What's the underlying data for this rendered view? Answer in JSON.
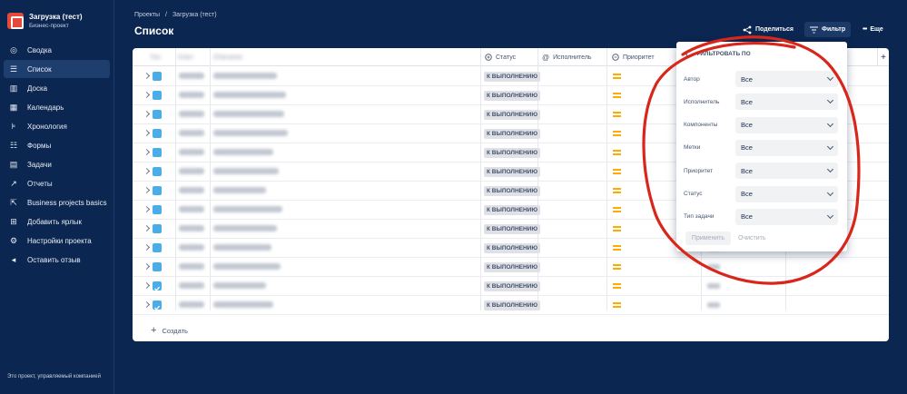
{
  "sidebar": {
    "project_name": "Загрузка (тест)",
    "project_type": "Бизнес-проект",
    "items": [
      {
        "label": "Сводка",
        "icon": "globe-icon"
      },
      {
        "label": "Список",
        "icon": "list-icon",
        "active": true
      },
      {
        "label": "Доска",
        "icon": "board-icon"
      },
      {
        "label": "Календарь",
        "icon": "calendar-icon"
      },
      {
        "label": "Хронология",
        "icon": "timeline-icon"
      },
      {
        "label": "Формы",
        "icon": "forms-icon"
      },
      {
        "label": "Задачи",
        "icon": "tasks-icon"
      },
      {
        "label": "Отчеты",
        "icon": "reports-icon"
      },
      {
        "label": "Business projects basics",
        "icon": "external-link-icon"
      },
      {
        "label": "Добавить ярлык",
        "icon": "add-shortcut-icon"
      },
      {
        "label": "Настройки проекта",
        "icon": "gear-icon"
      },
      {
        "label": "Оставить отзыв",
        "icon": "megaphone-icon"
      }
    ],
    "footer": "Это проект, управляемый компанией"
  },
  "header": {
    "breadcrumb": [
      "Проекты",
      "/",
      "Загрузка (тест)"
    ],
    "title": "Список",
    "share_label": "Поделиться",
    "filter_label": "Фильтр",
    "more_label": "Еще"
  },
  "table": {
    "columns": {
      "type": "Тип",
      "key": "Ключ",
      "summary": "Описание",
      "status": "Статус",
      "assignee": "Исполнитель",
      "priority": "Приоритет"
    },
    "rows": [
      {
        "status": "К ВЫПОЛНЕНИЮ",
        "checked": false
      },
      {
        "status": "К ВЫПОЛНЕНИЮ",
        "checked": false
      },
      {
        "status": "К ВЫПОЛНЕНИЮ",
        "checked": false
      },
      {
        "status": "К ВЫПОЛНЕНИЮ",
        "checked": false
      },
      {
        "status": "К ВЫПОЛНЕНИЮ",
        "checked": false
      },
      {
        "status": "К ВЫПОЛНЕНИЮ",
        "checked": false
      },
      {
        "status": "К ВЫПОЛНЕНИЮ",
        "checked": false
      },
      {
        "status": "К ВЫПОЛНЕНИЮ",
        "checked": false
      },
      {
        "status": "К ВЫПОЛНЕНИЮ",
        "checked": false
      },
      {
        "status": "К ВЫПОЛНЕНИЮ",
        "checked": false
      },
      {
        "status": "К ВЫПОЛНЕНИЮ",
        "checked": false
      },
      {
        "status": "К ВЫПОЛНЕНИЮ",
        "checked": true
      },
      {
        "status": "К ВЫПОЛНЕНИЮ",
        "checked": true
      }
    ],
    "create_label": "Создать",
    "add_column_label": "+"
  },
  "filter_panel": {
    "title": "ФИЛЬТРОВАТЬ ПО",
    "fields": [
      {
        "label": "Автор",
        "value": "Все"
      },
      {
        "label": "Исполнитель",
        "value": "Все"
      },
      {
        "label": "Компоненты",
        "value": "Все"
      },
      {
        "label": "Метки",
        "value": "Все"
      },
      {
        "label": "Приоритет",
        "value": "Все"
      },
      {
        "label": "Статус",
        "value": "Все"
      },
      {
        "label": "Тип задачи",
        "value": "Все"
      }
    ],
    "apply_label": "Применить",
    "clear_label": "Очистить"
  },
  "colors": {
    "background": "#0b2650",
    "annotation": "#d8261b",
    "priority_medium": "#ffab00",
    "task_type": "#4bade8"
  }
}
